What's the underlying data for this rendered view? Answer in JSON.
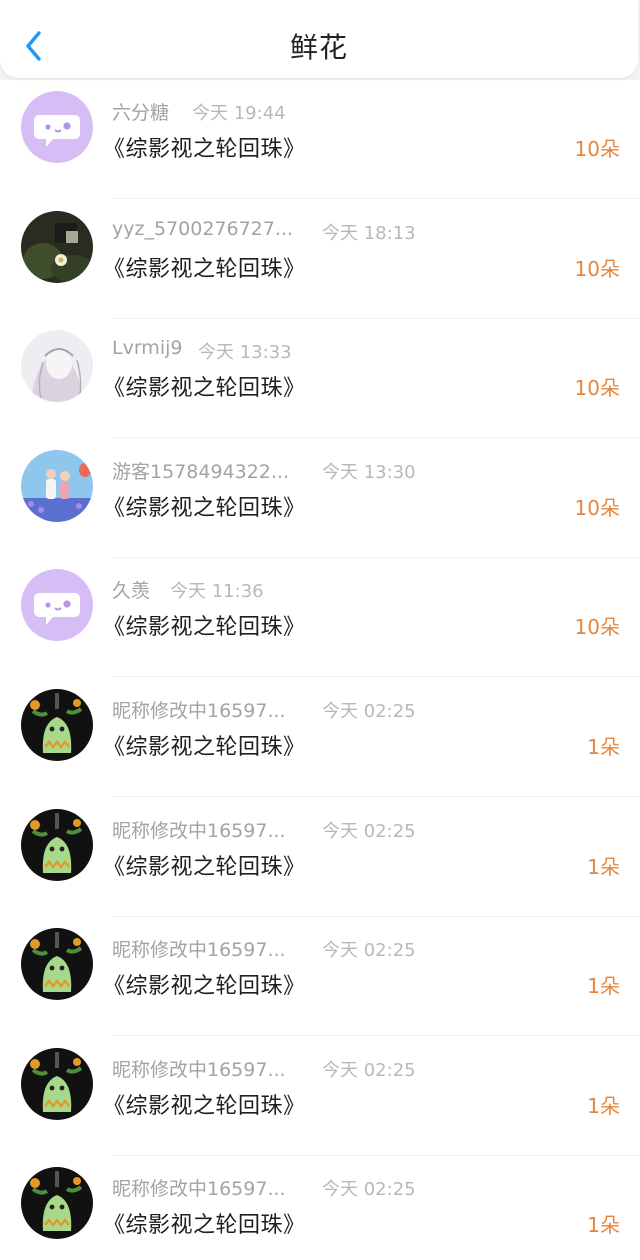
{
  "header": {
    "title": "鲜花",
    "back_icon": "chevron-left-icon",
    "accent_color": "#2196f3"
  },
  "flowers": [
    {
      "user": "六分糖",
      "time": "今天 19:44",
      "book": "《综影视之轮回珠》",
      "count": "10朵",
      "avatar": "chat-bubble-avatar"
    },
    {
      "user": "yyz_5700276727...",
      "time": "今天 18:13",
      "book": "《综影视之轮回珠》",
      "count": "10朵",
      "avatar": "photo-avatar"
    },
    {
      "user": "Lvrmij9",
      "time": "今天 13:33",
      "book": "《综影视之轮回珠》",
      "count": "10朵",
      "avatar": "sketch-avatar"
    },
    {
      "user": "游客1578494322...",
      "time": "今天 13:30",
      "book": "《综影视之轮回珠》",
      "count": "10朵",
      "avatar": "couple-photo-avatar"
    },
    {
      "user": "久羡",
      "time": "今天 11:36",
      "book": "《综影视之轮回珠》",
      "count": "10朵",
      "avatar": "chat-bubble-avatar"
    },
    {
      "user": "昵称修改中16597...",
      "time": "今天 02:25",
      "book": "《综影视之轮回珠》",
      "count": "1朵",
      "avatar": "cactus-avatar"
    },
    {
      "user": "昵称修改中16597...",
      "time": "今天 02:25",
      "book": "《综影视之轮回珠》",
      "count": "1朵",
      "avatar": "cactus-avatar"
    },
    {
      "user": "昵称修改中16597...",
      "time": "今天 02:25",
      "book": "《综影视之轮回珠》",
      "count": "1朵",
      "avatar": "cactus-avatar"
    },
    {
      "user": "昵称修改中16597...",
      "time": "今天 02:25",
      "book": "《综影视之轮回珠》",
      "count": "1朵",
      "avatar": "cactus-avatar"
    },
    {
      "user": "昵称修改中16597...",
      "time": "今天 02:25",
      "book": "《综影视之轮回珠》",
      "count": "1朵",
      "avatar": "cactus-avatar"
    }
  ],
  "colors": {
    "count": "#e8853a",
    "muted": "#a3a3a3",
    "title": "#222222"
  }
}
